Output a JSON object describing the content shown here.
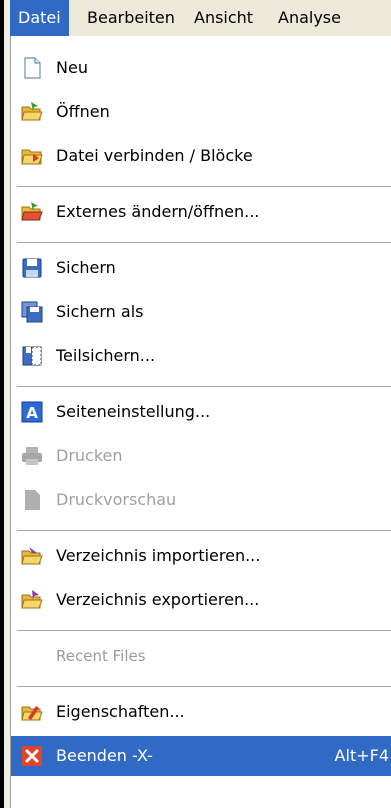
{
  "menubar": {
    "items": [
      "Datei",
      "Bearbeiten",
      "Ansicht",
      "Analyse"
    ]
  },
  "menu": {
    "items": [
      {
        "label": "Neu",
        "icon": "new-document-icon"
      },
      {
        "label": "Öffnen",
        "icon": "open-folder-icon"
      },
      {
        "label": "Datei verbinden / Blöcke",
        "icon": "merge-folder-icon"
      },
      {
        "label": "Externes ändern/öffnen...",
        "icon": "external-edit-icon"
      },
      {
        "label": "Sichern",
        "icon": "save-disk-icon"
      },
      {
        "label": "Sichern als",
        "icon": "save-as-icon"
      },
      {
        "label": "Teilsichern...",
        "icon": "partial-save-icon"
      },
      {
        "label": "Seiteneinstellung...",
        "icon": "page-setup-icon"
      },
      {
        "label": "Drucken",
        "icon": "print-icon",
        "disabled": true
      },
      {
        "label": "Druckvorschau",
        "icon": "print-preview-icon",
        "disabled": true
      },
      {
        "label": "Verzeichnis importieren...",
        "icon": "import-folder-icon"
      },
      {
        "label": "Verzeichnis exportieren...",
        "icon": "export-folder-icon"
      },
      {
        "label": "Recent Files",
        "disabled": true
      },
      {
        "label": "Eigenschaften...",
        "icon": "properties-icon"
      },
      {
        "label": "Beenden -X-",
        "shortcut": "Alt+F4",
        "icon": "exit-icon",
        "selected": true
      }
    ]
  },
  "colors": {
    "menubar_bg": "#ece9d8",
    "selection": "#316ac5",
    "disabled_text": "#a0a0a0"
  }
}
